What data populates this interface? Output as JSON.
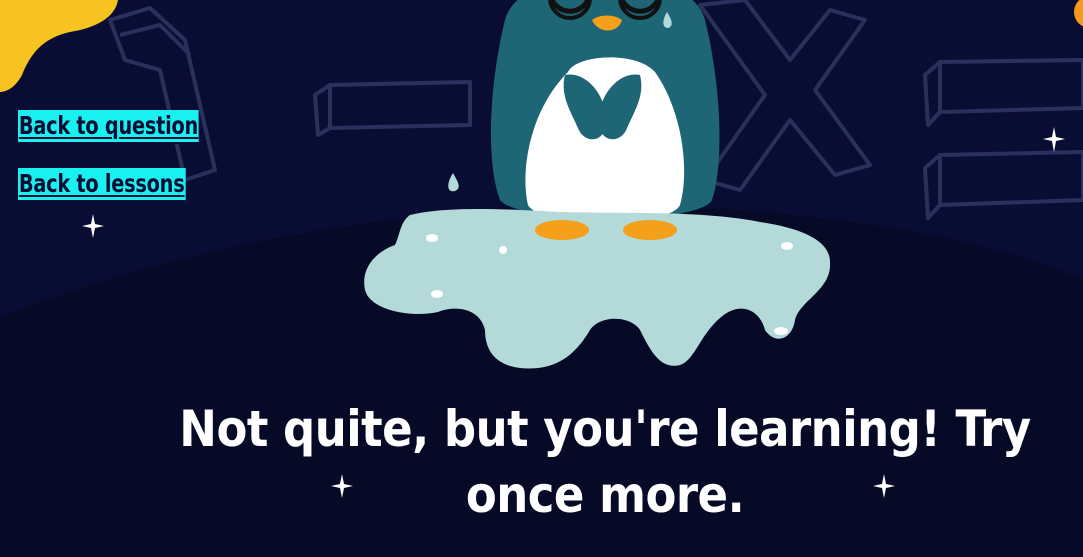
{
  "nav": {
    "back_to_question": "Back to question",
    "back_to_lessons": "Back to lessons"
  },
  "feedback": {
    "message": "Not quite, but you're learning! Try once more."
  },
  "colors": {
    "background": "#0a0d33",
    "ground": "#070a26",
    "link_highlight": "#19f0f0",
    "penguin_body": "#1e6575",
    "penguin_belly": "#ffffff",
    "penguin_feet": "#f5a01b",
    "ice": "#b3d9d8",
    "accent_blob": "#f7c320"
  },
  "icons": [
    "sparkle-icon",
    "teardrop-icon"
  ]
}
